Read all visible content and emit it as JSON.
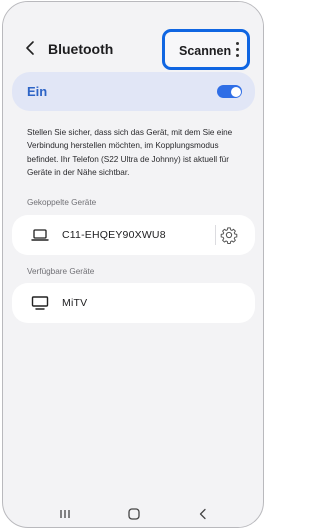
{
  "header": {
    "title": "Bluetooth",
    "scan_label": "Scannen"
  },
  "toggle": {
    "label": "Ein",
    "state": "on"
  },
  "description": "Stellen Sie sicher, dass sich das Gerät, mit dem Sie eine Verbindung herstellen möchten, im Kopplungsmodus befindet. Ihr Telefon (S22 Ultra de Johnny) ist aktuell für Geräte in der Nähe sichtbar.",
  "paired": {
    "heading": "Gekoppelte Geräte",
    "devices": [
      {
        "name": "C11-EHQEY90XWU8",
        "icon": "laptop-icon"
      }
    ]
  },
  "available": {
    "heading": "Verfügbare Geräte",
    "devices": [
      {
        "name": "MiTV",
        "icon": "monitor-icon"
      }
    ]
  },
  "colors": {
    "accent": "#2f6ee6",
    "highlight_box": "#1066e2",
    "toggle_card": "#e1e6f6",
    "background": "#f3f3f5"
  },
  "navbar": [
    "recents-icon",
    "home-icon",
    "back-nav-icon"
  ]
}
